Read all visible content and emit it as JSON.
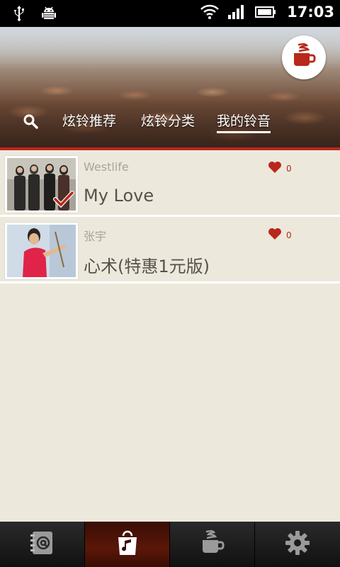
{
  "status_bar": {
    "time": "17:03",
    "icons": [
      "usb-icon",
      "android-debug-icon",
      "wifi-icon",
      "signal-icon",
      "battery-icon"
    ]
  },
  "header": {
    "logo_icon": "coffee-cup-icon",
    "search_icon": "search-icon",
    "tabs": [
      {
        "label": "炫铃推荐",
        "active": false
      },
      {
        "label": "炫铃分类",
        "active": false
      },
      {
        "label": "我的铃音",
        "active": true
      }
    ]
  },
  "songs": [
    {
      "artist": "Westlife",
      "title": "My Love",
      "likes": "0",
      "selected": true
    },
    {
      "artist": "张宇",
      "title": "心术(特惠1元版)",
      "likes": "0",
      "selected": false
    }
  ],
  "bottom_nav": [
    {
      "icon": "contacts-icon",
      "active": false
    },
    {
      "icon": "shopping-bag-music-icon",
      "active": true
    },
    {
      "icon": "coffee-cup-icon",
      "active": false
    },
    {
      "icon": "gear-icon",
      "active": false
    }
  ],
  "colors": {
    "accent": "#B8281B",
    "background": "#ECE8DC",
    "title_text": "#55524C",
    "artist_text": "#A8A598"
  }
}
